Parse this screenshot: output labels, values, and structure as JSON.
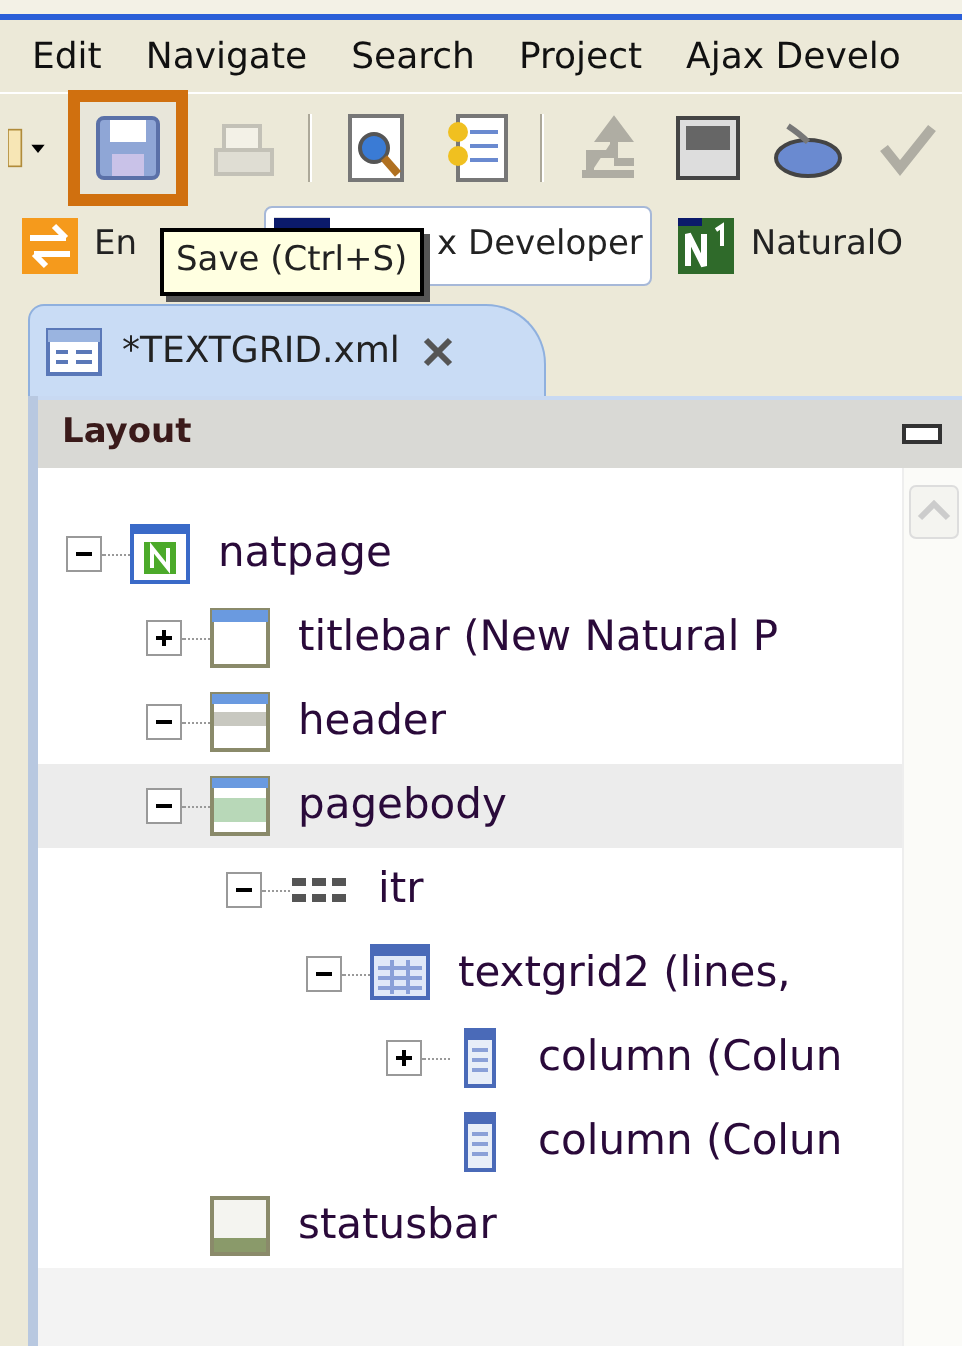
{
  "menu": [
    {
      "label": "Edit"
    },
    {
      "label": "Navigate"
    },
    {
      "label": "Search"
    },
    {
      "label": "Project"
    },
    {
      "label": "Ajax Develo"
    }
  ],
  "toolbar": [
    {
      "kind": "new",
      "disabled": false,
      "highlighted": false
    },
    {
      "kind": "save",
      "disabled": false,
      "highlighted": true
    },
    {
      "kind": "print",
      "disabled": true,
      "highlighted": false
    },
    {
      "kind": "separator"
    },
    {
      "kind": "preview",
      "disabled": false,
      "highlighted": false
    },
    {
      "kind": "compare",
      "disabled": false,
      "highlighted": false
    },
    {
      "kind": "separator"
    },
    {
      "kind": "deploy",
      "disabled": true,
      "highlighted": false
    },
    {
      "kind": "css",
      "disabled": false,
      "highlighted": false
    },
    {
      "kind": "keyboard",
      "disabled": false,
      "highlighted": false
    },
    {
      "kind": "check",
      "disabled": true,
      "highlighted": false
    }
  ],
  "tooltip": {
    "text": "Save (Ctrl+S)"
  },
  "perspectives": [
    {
      "label": "En",
      "kind": "enterprise",
      "selected": false
    },
    {
      "label": "x Developer",
      "kind": "ajax",
      "selected": true
    },
    {
      "label": "NaturalO",
      "kind": "natural",
      "selected": false
    }
  ],
  "editor_tab": {
    "title": "*TEXTGRID.xml",
    "selected": true
  },
  "panel": {
    "title": "Layout",
    "tree": [
      {
        "label": "natpage",
        "kind": "natural",
        "expanded": true,
        "selected": false,
        "children": [
          {
            "label": "titlebar (New Natural P",
            "kind": "window",
            "expanded": false,
            "selected": false
          },
          {
            "label": "header",
            "kind": "section",
            "expanded": true,
            "selected": false
          },
          {
            "label": "pagebody",
            "kind": "body",
            "expanded": true,
            "selected": true,
            "children": [
              {
                "label": "itr",
                "kind": "iterator",
                "expanded": true,
                "selected": false,
                "children": [
                  {
                    "label": "textgrid2 (lines,",
                    "kind": "grid",
                    "expanded": true,
                    "selected": false,
                    "children": [
                      {
                        "label": "column (Colun",
                        "kind": "column",
                        "expanded": false,
                        "selected": false
                      },
                      {
                        "label": "column (Colun",
                        "kind": "column",
                        "selected": false
                      }
                    ]
                  }
                ]
              }
            ]
          },
          {
            "label": "statusbar",
            "kind": "statusbar",
            "selected": false
          }
        ]
      }
    ]
  }
}
